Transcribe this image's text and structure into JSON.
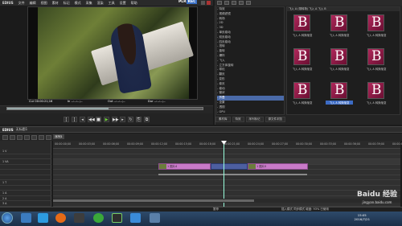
{
  "app": {
    "logo": "EDIUS",
    "menu": [
      "文件",
      "编辑",
      "视图",
      "素材",
      "标记",
      "模式",
      "采集",
      "渲染",
      "工具",
      "设置",
      "帮助"
    ],
    "plr_prefix": "PLR",
    "plr_mode": "REC"
  },
  "preview": {
    "timecodes": [
      "Cur 00:00:21;16",
      "In --:--:--;--",
      "Out --:--:--;--",
      "Dur --:--:--;--"
    ]
  },
  "right_panel": {
    "tree_items": [
      "- 特效",
      "  - 视频滤镜",
      "   - 转场",
      "    - 2D",
      "    - 3D",
      "    - 单页卷动",
      "    - 双页卷动",
      "    - 四页卷动",
      "    - 扭转",
      "    - 旋转",
      "    - 爆炸",
      "    - 飞入",
      "    - 立方体旋转",
      "    - 球化",
      "    - 翻页",
      "    - 变形",
      "    - 卷页",
      "    - 卷动",
      "    - 管状",
      "    - 折叠",
      "    - 全景",
      "    - 透视",
      "  - GPU",
      "   - 音频滤镜",
      "  - 字幕混合",
      "  - 键"
    ],
    "tree_selected_index": 19,
    "thumb_header": "飞入 A (带转场)  飞入 A  飞入 B",
    "thumbs": [
      {
        "label": "飞入 A 转换渐变",
        "selected": false
      },
      {
        "label": "飞入 A 转换渐变",
        "selected": false
      },
      {
        "label": "飞入 A 转换渐变",
        "selected": false
      },
      {
        "label": "飞入 A 转换渐变",
        "selected": false
      },
      {
        "label": "飞入 A 转换渐变",
        "selected": false
      },
      {
        "label": "飞入 A 转换渐变",
        "selected": false
      },
      {
        "label": "飞入 A 转换渐变",
        "selected": false
      },
      {
        "label": "飞入 A 转换渐变",
        "selected": true
      },
      {
        "label": "飞入 A 转换渐变",
        "selected": false
      }
    ],
    "thumb_letter": "B",
    "tabs": [
      "素材库",
      "特效",
      "序列标记",
      "源文件浏览"
    ]
  },
  "timeline": {
    "title": "EDIUS",
    "sequence": "无标题1",
    "seq_tab": "序列1",
    "ruler_ticks": [
      "00:00:00;00",
      "00:00:03;00",
      "00:00:06;00",
      "00:00:09;00",
      "00:00:12;00",
      "00:00:15;00",
      "00:00:18;00",
      "00:00:21;00",
      "00:00:24;00",
      "00:00:27;00",
      "00:00:30;00",
      "00:00:33;00",
      "00:00:36;00",
      "00:00:39;00",
      "00:00:42;00"
    ],
    "tracks": [
      "1 V",
      "",
      "1 VA",
      "",
      "",
      "",
      "1 T",
      "",
      "1 A",
      "2 A",
      "3 A",
      "4 A"
    ],
    "clips": [
      "1 图片4",
      "1 图片5"
    ],
    "bottom_left": "暂停",
    "bottom_right": "插入模式  同步模式  磁盘: 93% 已使用"
  },
  "taskbar": {
    "time": "15:05",
    "date": "2016/7/21"
  },
  "watermark": {
    "main": "Baidu 经验",
    "sub": "jingyan.baidu.com"
  }
}
